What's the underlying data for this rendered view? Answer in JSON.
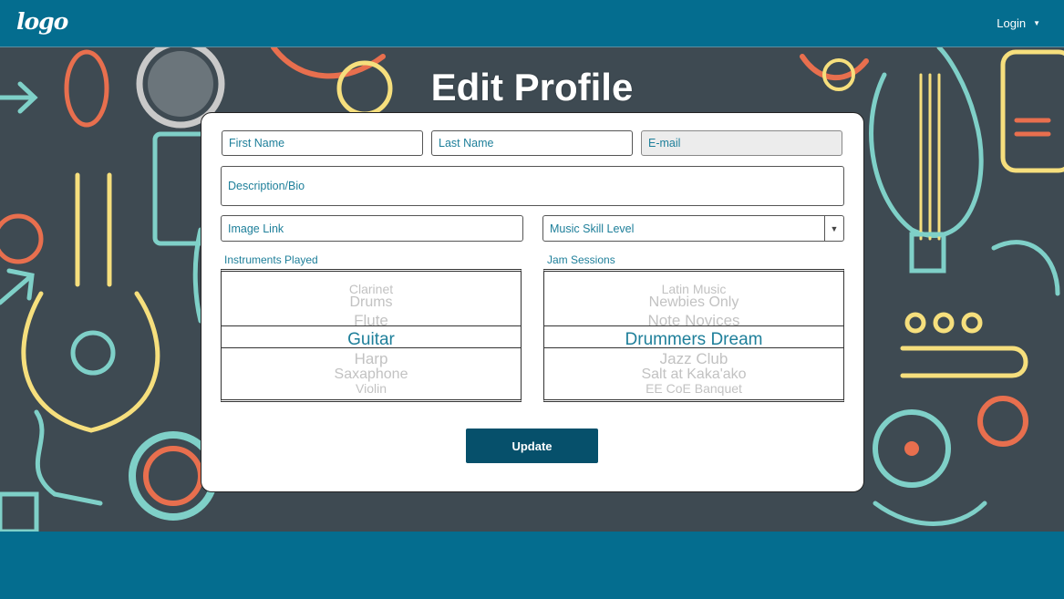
{
  "header": {
    "logo_text": "logo",
    "login_label": "Login",
    "login_caret_icon": "caret-down-icon"
  },
  "page": {
    "title": "Edit Profile"
  },
  "form": {
    "first_name_placeholder": "First Name",
    "last_name_placeholder": "Last Name",
    "email_placeholder": "E-mail",
    "bio_placeholder": "Description/Bio",
    "image_link_placeholder": "Image Link",
    "skill_level_value": "Music Skill Level",
    "instruments_label": "Instruments Played",
    "instruments_options": [
      "Clarinet",
      "Drums",
      "Flute",
      "Guitar",
      "Harp",
      "Saxaphone",
      "Violin"
    ],
    "instruments_selected": "Guitar",
    "jam_label": "Jam Sessions",
    "jam_options": [
      "Latin Music",
      "Newbies Only",
      "Note Novices",
      "Drummers Dream",
      "Jazz Club",
      "Salt at Kaka'ako",
      "EE CoE Banquet"
    ],
    "jam_selected": "Drummers Dream",
    "update_label": "Update"
  },
  "colors": {
    "brand": "#046d8f",
    "button": "#06506b",
    "accent_text": "#1e7f9a",
    "hero_background": "#3e4a52"
  }
}
